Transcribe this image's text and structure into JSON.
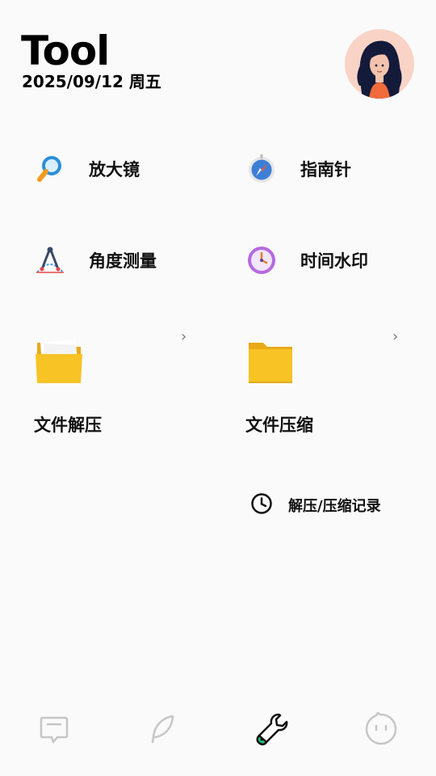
{
  "header": {
    "title": "Tool",
    "date": "2025/09/12 周五"
  },
  "tools": [
    {
      "label": "放大镜",
      "icon": "magnifier-icon"
    },
    {
      "label": "指南针",
      "icon": "compass-icon"
    },
    {
      "label": "角度测量",
      "icon": "protractor-icon"
    },
    {
      "label": "时间水印",
      "icon": "clock-watermark-icon"
    }
  ],
  "file_cards": [
    {
      "label": "文件解压",
      "icon": "open-folder-icon"
    },
    {
      "label": "文件压缩",
      "icon": "folder-icon"
    }
  ],
  "history": {
    "label": "解压/压缩记录",
    "icon": "clock-icon"
  },
  "tabbar": {
    "items": [
      {
        "name": "messages",
        "icon": "message-icon",
        "active": false
      },
      {
        "name": "notes",
        "icon": "feather-icon",
        "active": false
      },
      {
        "name": "tools",
        "icon": "wrench-icon",
        "active": true
      },
      {
        "name": "me",
        "icon": "face-icon",
        "active": false
      }
    ]
  },
  "colors": {
    "background": "#fafafa",
    "avatar_bg": "#f9d3c6",
    "folder_yellow": "#f7c325",
    "active_tab_green": "#22c37a"
  }
}
